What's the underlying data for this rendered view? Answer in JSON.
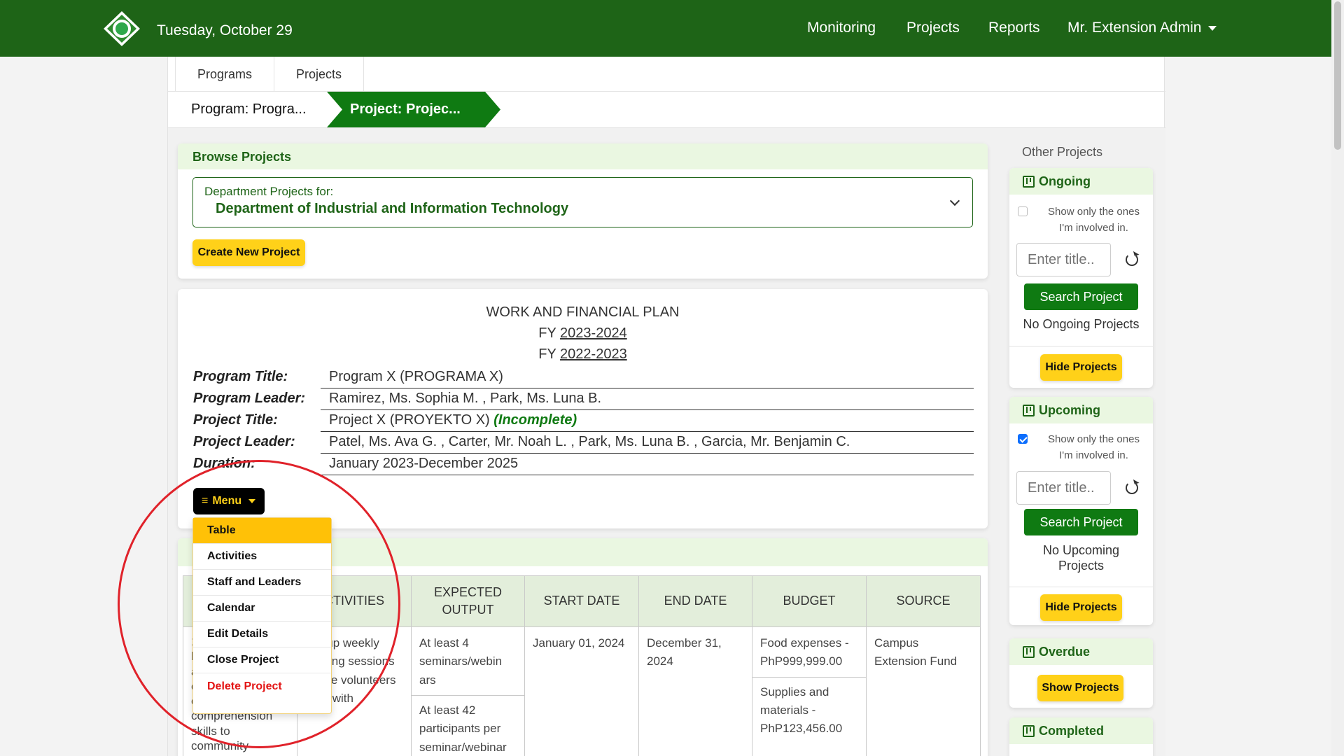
{
  "navbar": {
    "date": "Tuesday, October 29",
    "links": [
      "Monitoring",
      "Projects",
      "Reports"
    ],
    "user": "Mr. Extension Admin"
  },
  "tabs": [
    "Programs",
    "Projects"
  ],
  "breadcrumb": {
    "program": "Program: Progra...",
    "project": "Project: Projec..."
  },
  "browse": {
    "title": "Browse Projects",
    "dept_label": "Department Projects for:",
    "dept_name": "Department of Industrial and Information Technology",
    "create_button": "Create New Project"
  },
  "plan": {
    "title": "WORK AND FINANCIAL PLAN",
    "fy_prefix": "FY",
    "fy_years": [
      "2023-2024",
      "2022-2023"
    ],
    "rows": [
      {
        "key": "Program Title:",
        "value": "Program X (PROGRAMA X)"
      },
      {
        "key": "Program Leader:",
        "value": "Ramirez, Ms. Sophia M. , Park, Ms. Luna B."
      },
      {
        "key": "Project Title:",
        "value": "Project X (PROYEKTO X)",
        "status": "(Incomplete)"
      },
      {
        "key": "Project Leader:",
        "value": "Patel, Ms. Ava G. , Carter, Mr. Noah L. , Park, Ms. Luna B. , Garcia, Mr. Benjamin C."
      },
      {
        "key": "Duration:",
        "value": "January 2023-December 2025"
      }
    ],
    "menu_button": "Menu"
  },
  "menu": {
    "items": [
      "Table",
      "Activities",
      "Staff and Leaders",
      "Calendar",
      "Edit Details",
      "Close Project",
      "Delete Project"
    ],
    "active": "Table"
  },
  "table": {
    "headers": [
      "",
      "CTIVITIES",
      "EXPECTED OUTPUT",
      "START DATE",
      "END DATE",
      "BUDGET",
      "SOURCE"
    ],
    "col1_fragments": [
      "1",
      "l",
      "a",
      "c",
      "c",
      "comprehension",
      "skills to",
      "community"
    ],
    "activities": "Set up weekly reading sessions where volunteers read with",
    "outputs": [
      "At least 4 seminars/webin ars",
      "At least 42 participants per seminar/webinar"
    ],
    "start_date": "January 01, 2024",
    "end_date": "December 31, 2024",
    "budget": [
      "Food expenses - PhP999,999.00",
      "Supplies and materials - PhP123,456.00"
    ],
    "source": "Campus Extension Fund"
  },
  "sidebar": {
    "title": "Other Projects",
    "ongoing": {
      "title": "Ongoing",
      "checkbox_label": "Show only the ones I'm involved in.",
      "checked": false,
      "placeholder": "Enter title..",
      "search_button": "Search Project",
      "empty": "No Ongoing Projects",
      "toggle_button": "Hide Projects"
    },
    "upcoming": {
      "title": "Upcoming",
      "checkbox_label": "Show only the ones I'm involved in.",
      "checked": true,
      "placeholder": "Enter title..",
      "search_button": "Search Project",
      "empty": "No Upcoming Projects",
      "toggle_button": "Hide Projects"
    },
    "overdue": {
      "title": "Overdue",
      "toggle_button": "Show Projects"
    },
    "completed": {
      "title": "Completed"
    }
  },
  "colors": {
    "brand_green": "#1e6417",
    "button_green": "#0f7a12",
    "accent_yellow": "#ffd119",
    "header_tint": "#eaf7e1",
    "danger": "#e31414",
    "annotation_red": "#e0222a"
  }
}
